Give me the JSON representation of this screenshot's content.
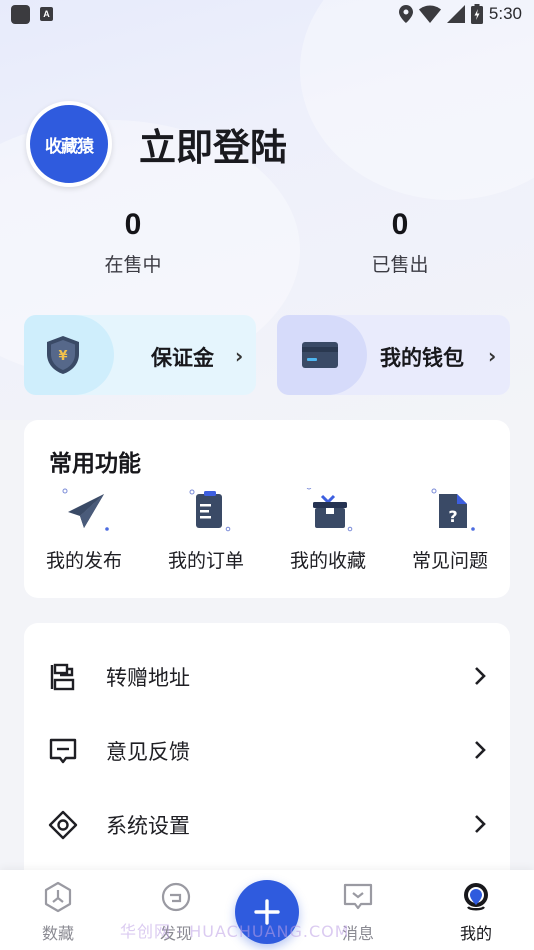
{
  "status_bar": {
    "time": "5:30",
    "left_icons": [
      "app-notification-icon",
      "keyboard-a-icon"
    ],
    "right_icons": [
      "location-icon",
      "wifi-icon",
      "signal-icon",
      "battery-icon"
    ],
    "small_glyph": "A"
  },
  "profile": {
    "avatar_text": "收藏猿",
    "login_text": "立即登陆"
  },
  "stats": [
    {
      "value": "0",
      "label": "在售中"
    },
    {
      "value": "0",
      "label": "已售出"
    }
  ],
  "quick_cards": [
    {
      "label": "保证金",
      "icon": "shield-yen-icon",
      "arrow": "›"
    },
    {
      "label": "我的钱包",
      "icon": "wallet-card-icon",
      "arrow": "›"
    }
  ],
  "common_functions": {
    "title": "常用功能",
    "items": [
      {
        "label": "我的发布",
        "icon": "paper-plane-icon"
      },
      {
        "label": "我的订单",
        "icon": "clipboard-list-icon"
      },
      {
        "label": "我的收藏",
        "icon": "gift-box-icon"
      },
      {
        "label": "常见问题",
        "icon": "question-doc-icon"
      }
    ]
  },
  "menu": [
    {
      "label": "转赠地址",
      "icon": "address-transfer-icon"
    },
    {
      "label": "意见反馈",
      "icon": "feedback-message-icon"
    },
    {
      "label": "系统设置",
      "icon": "settings-hex-icon"
    }
  ],
  "tabs": [
    {
      "label": "数藏",
      "icon": "collection-hex-icon",
      "active": false
    },
    {
      "label": "发现",
      "icon": "discover-icon",
      "active": false
    },
    {
      "label": "消息",
      "icon": "message-icon",
      "active": false
    },
    {
      "label": "我的",
      "icon": "profile-pin-icon",
      "active": true
    }
  ],
  "fab": {
    "icon": "plus-icon"
  },
  "watermark": "华创网 · HUACHUANG.COM",
  "colors": {
    "brand_blue": "#2f5bde",
    "page_bg": "#f3f4f8",
    "deposit_card": "#e5f5fd",
    "wallet_card": "#e9ebfc"
  }
}
